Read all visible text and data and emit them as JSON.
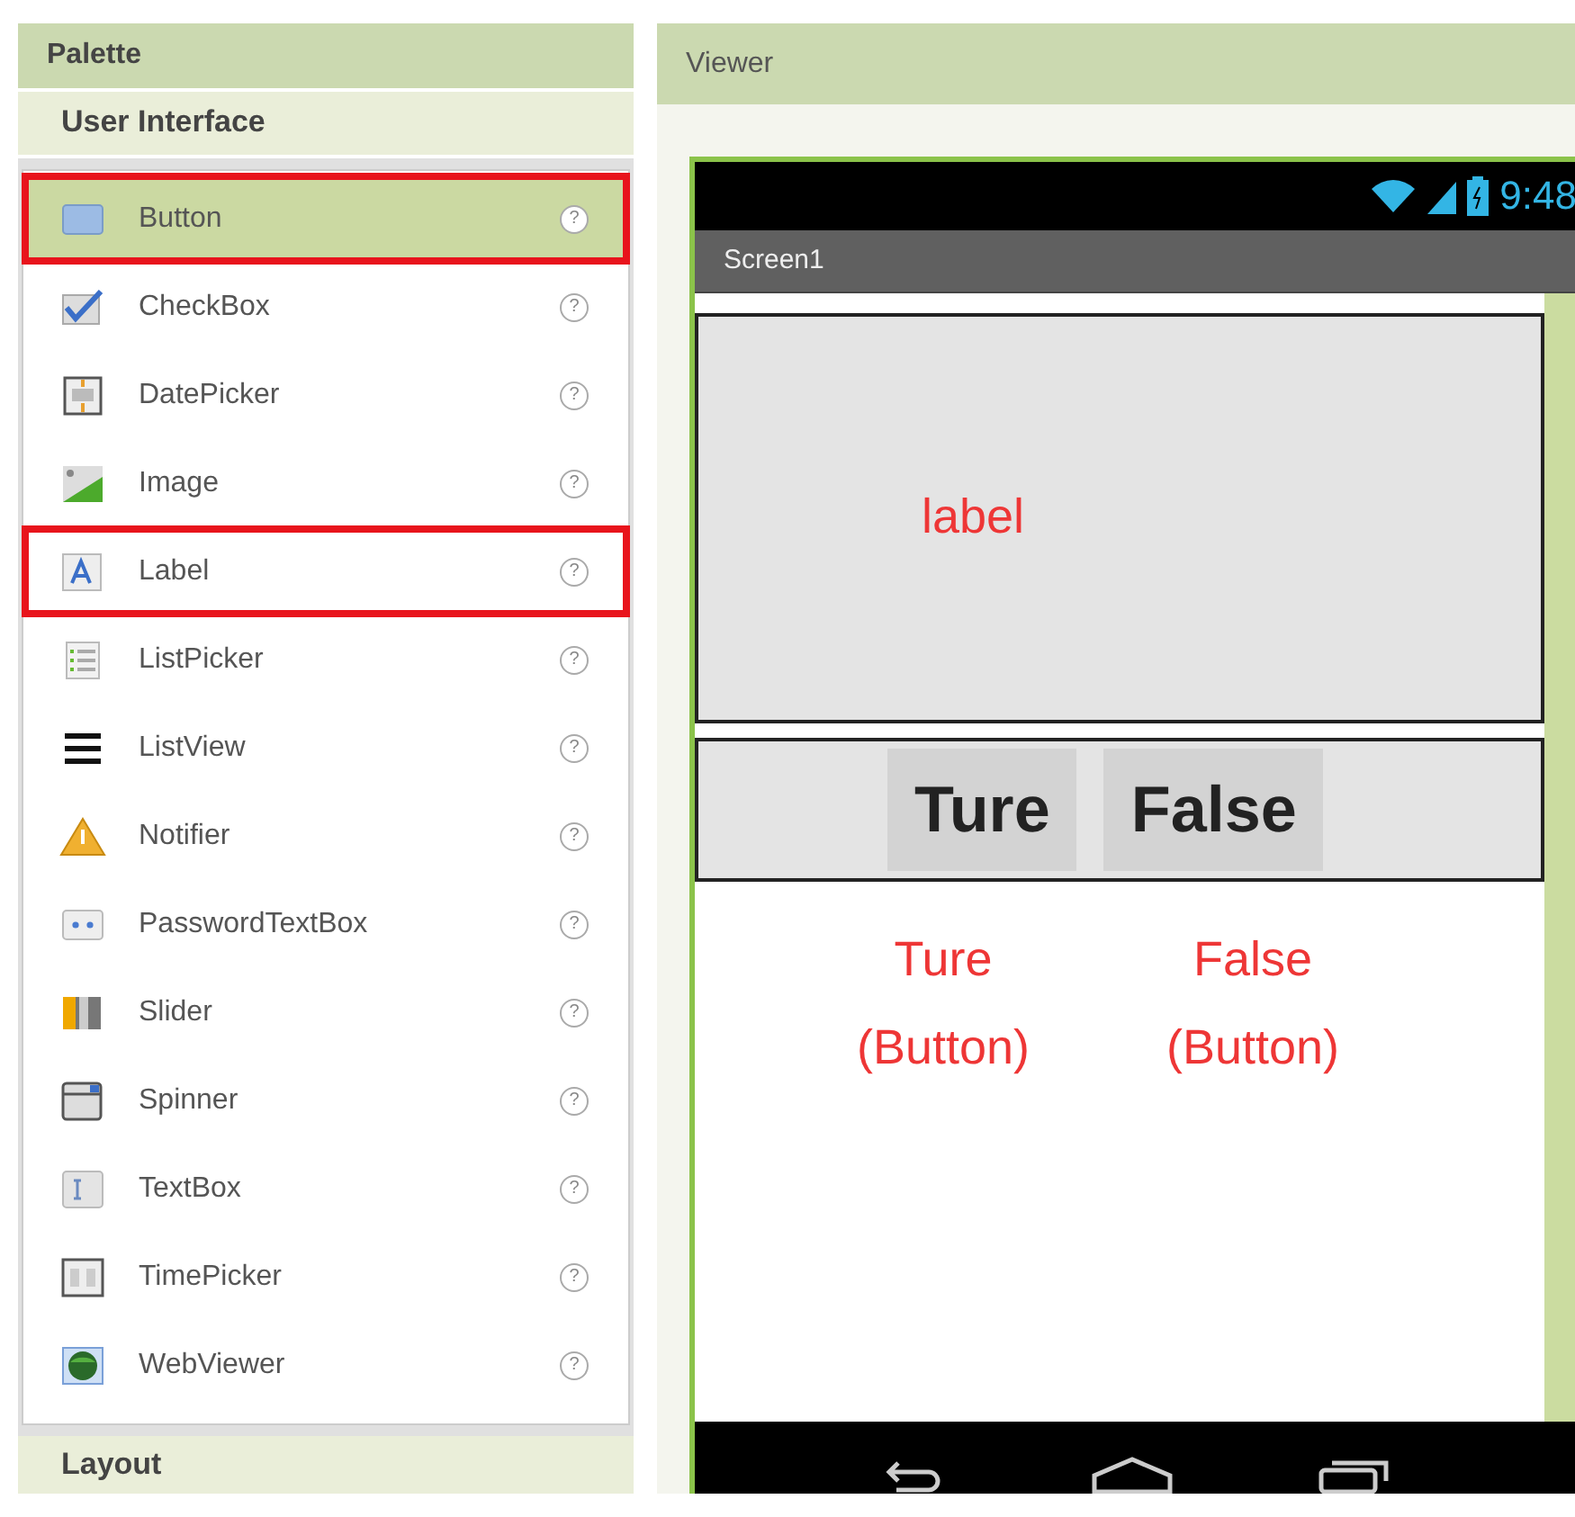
{
  "palette": {
    "title": "Palette",
    "section": "User Interface",
    "items": [
      {
        "label": "Button",
        "kind": "button",
        "selected": true,
        "highlighted": true,
        "help": "?"
      },
      {
        "label": "CheckBox",
        "kind": "checkbox",
        "selected": false,
        "highlighted": false,
        "help": "?"
      },
      {
        "label": "DatePicker",
        "kind": "datepicker",
        "selected": false,
        "highlighted": false,
        "help": "?"
      },
      {
        "label": "Image",
        "kind": "image",
        "selected": false,
        "highlighted": false,
        "help": "?"
      },
      {
        "label": "Label",
        "kind": "label",
        "selected": false,
        "highlighted": true,
        "help": "?"
      },
      {
        "label": "ListPicker",
        "kind": "listpicker",
        "selected": false,
        "highlighted": false,
        "help": "?"
      },
      {
        "label": "ListView",
        "kind": "listview",
        "selected": false,
        "highlighted": false,
        "help": "?"
      },
      {
        "label": "Notifier",
        "kind": "notifier",
        "selected": false,
        "highlighted": false,
        "help": "?"
      },
      {
        "label": "PasswordTextBox",
        "kind": "password",
        "selected": false,
        "highlighted": false,
        "help": "?"
      },
      {
        "label": "Slider",
        "kind": "slider",
        "selected": false,
        "highlighted": false,
        "help": "?"
      },
      {
        "label": "Spinner",
        "kind": "spinner",
        "selected": false,
        "highlighted": false,
        "help": "?"
      },
      {
        "label": "TextBox",
        "kind": "textbox",
        "selected": false,
        "highlighted": false,
        "help": "?"
      },
      {
        "label": "TimePicker",
        "kind": "timepicker",
        "selected": false,
        "highlighted": false,
        "help": "?"
      },
      {
        "label": "WebViewer",
        "kind": "webviewer",
        "selected": false,
        "highlighted": false,
        "help": "?"
      }
    ],
    "next_section": "Layout"
  },
  "viewer": {
    "title": "Viewer",
    "phone": {
      "time": "9:48",
      "screen_title": "Screen1",
      "label_annotation": "label",
      "buttons": [
        {
          "text": "Ture",
          "annotation": [
            "Ture",
            "(Button)"
          ]
        },
        {
          "text": "False",
          "annotation": [
            "False",
            "(Button)"
          ]
        }
      ]
    }
  }
}
